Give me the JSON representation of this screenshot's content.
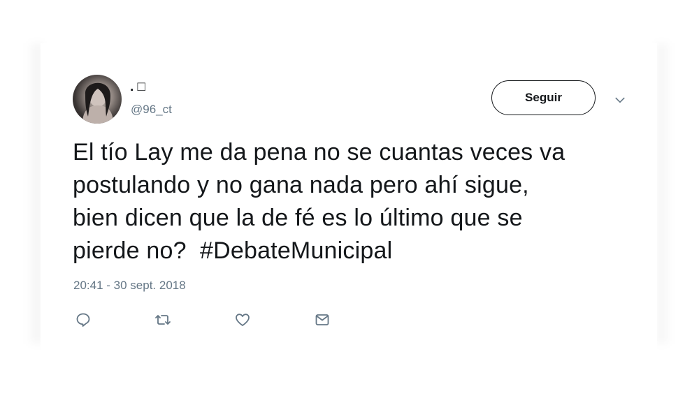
{
  "tweet": {
    "author": {
      "display_name": ". □",
      "handle": "@96_ct",
      "avatar_icon": "user-photo"
    },
    "follow_label": "Seguir",
    "menu_icon": "chevron-down-icon",
    "text_lines": [
      "El tío Lay me da pena no se cuantas veces va",
      "postulando y no gana nada pero ahí sigue,",
      "bien dicen que la de fé es lo último que se",
      "pierde no?  "
    ],
    "hashtag": "#DebateMunicipal",
    "timestamp": "20:41 - 30 sept. 2018",
    "actions": [
      {
        "icon": "reply-icon"
      },
      {
        "icon": "retweet-icon"
      },
      {
        "icon": "like-icon"
      },
      {
        "icon": "message-icon"
      }
    ]
  },
  "colors": {
    "text": "#14171a",
    "secondary": "#657786",
    "icon": "#657786"
  }
}
